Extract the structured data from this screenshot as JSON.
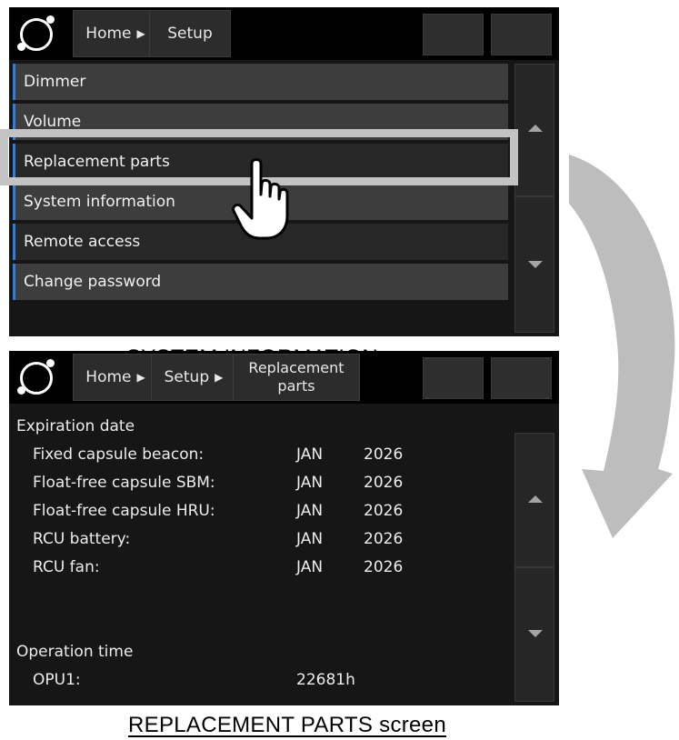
{
  "screen1": {
    "breadcrumb": {
      "home": "Home",
      "current": "Setup"
    },
    "menu": [
      "Dimmer",
      "Volume",
      "Replacement parts",
      "System information",
      "Remote access",
      "Change password"
    ],
    "highlighted": "Replacement parts",
    "caption": "SYSTEM INFORMATION screen"
  },
  "screen2": {
    "breadcrumb": {
      "home": "Home",
      "setup": "Setup",
      "current_line1": "Replacement",
      "current_line2": "parts"
    },
    "expiration_heading": "Expiration date",
    "expiration_rows": [
      {
        "label": "Fixed capsule beacon:",
        "month": "JAN",
        "year": "2026"
      },
      {
        "label": "Float-free capsule SBM:",
        "month": "JAN",
        "year": "2026"
      },
      {
        "label": "Float-free capsule HRU:",
        "month": "JAN",
        "year": "2026"
      },
      {
        "label": "RCU battery:",
        "month": "JAN",
        "year": "2026"
      },
      {
        "label": "RCU fan:",
        "month": "JAN",
        "year": "2026"
      }
    ],
    "operation_heading": "Operation time",
    "operation_rows": [
      {
        "label": "OPU1:",
        "value": "22681h"
      }
    ],
    "caption": "REPLACEMENT PARTS screen"
  },
  "icons": {
    "logo": "ring-logo-icon",
    "scroll_up": "triangle-up-icon",
    "scroll_down": "triangle-down-icon",
    "breadcrumb_arrow": "triangle-right-icon",
    "pointer": "hand-pointer-icon",
    "transition": "curved-arrow-icon"
  },
  "colors": {
    "menu_accent": "#2f7de1",
    "screen_bg": "#161616",
    "highlight_frame": "#c3c3c3",
    "transition_arrow": "#bdbdbd"
  }
}
